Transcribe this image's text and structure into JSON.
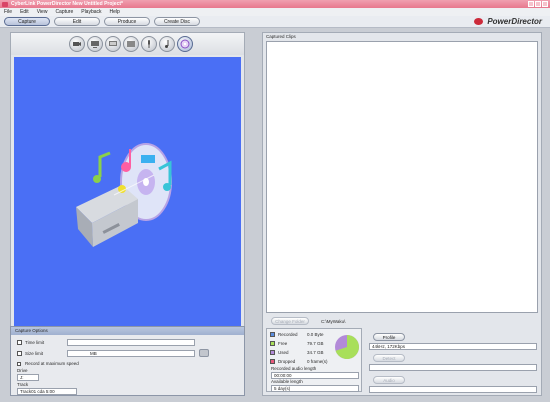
{
  "window": {
    "title": "CyberLink PowerDirector New Untitled Project*"
  },
  "menu": [
    "File",
    "Edit",
    "View",
    "Capture",
    "Playback",
    "Help"
  ],
  "tabs": [
    {
      "label": "Capture",
      "active": true
    },
    {
      "label": "Edit",
      "active": false
    },
    {
      "label": "Produce",
      "active": false
    },
    {
      "label": "Create Disc",
      "active": false
    }
  ],
  "brand": {
    "name": "PowerDirector",
    "accent": "#cc2a3a"
  },
  "capture_modes": [
    "dv-camcorder-icon",
    "tv-icon",
    "digital-tv-icon",
    "webcam-icon",
    "microphone-icon",
    "cd-icon",
    "disc-icon"
  ],
  "preview": {
    "background": "#4a6ff5"
  },
  "playback": [
    "play-icon",
    "stop-icon",
    "pause-icon",
    "previous-icon",
    "next-icon",
    "eject-icon",
    "volume-icon",
    "record-icon"
  ],
  "capture_options": {
    "header": "Capture Options",
    "time_limit_label": "Time limit",
    "size_limit_label": "Size limit",
    "size_unit": "MB",
    "max_speed_label": "Record at maximum speed",
    "drive_label": "Drive",
    "drive_value": "J:",
    "track_label": "Track",
    "track_value": "Track01 cda  5:00"
  },
  "captured_clips": {
    "label": "Captured Clips"
  },
  "folder": {
    "change_button": "Change Folder",
    "path": "C:\\MyWaku\\"
  },
  "disk": {
    "items": [
      {
        "label": "Recorded",
        "value": "0.0  Byte",
        "color": "#5b8ee0"
      },
      {
        "label": "Free",
        "value": "79.7  GB",
        "color": "#a8df5a"
      },
      {
        "label": "Used",
        "value": "34.7  GB",
        "color": "#b28ad8"
      },
      {
        "label": "Dropped",
        "value": "0 frame(s)",
        "color": "#e85a7c"
      }
    ],
    "recorded_length_label": "Recorded audio length",
    "recorded_length_value": "00:00:00",
    "available_length_label": "Available length",
    "available_length_value": "5 day(s)",
    "free_fraction": 0.7
  },
  "profile": {
    "button": "Profile",
    "value": "44kHz, 172Kbps",
    "button2": "Detect",
    "button3": "Audio"
  }
}
